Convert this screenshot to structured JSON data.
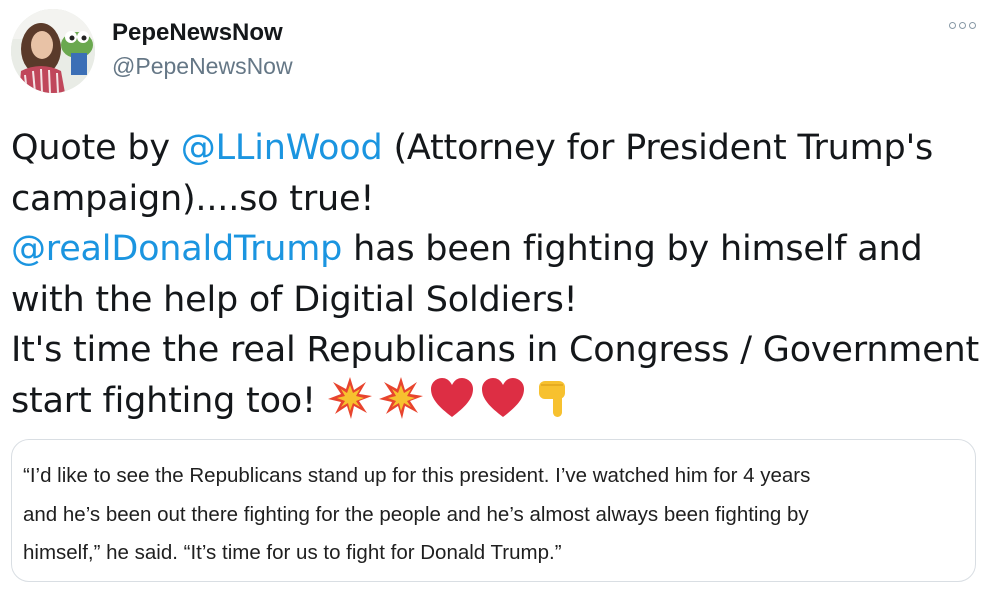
{
  "user": {
    "display_name": "PepeNewsNow",
    "handle": "@PepeNewsNow",
    "avatar_icon": "profile-photo"
  },
  "more_icon": "more-options-icon",
  "tweet": {
    "line1": {
      "pre": "Quote by ",
      "mention": "@LLinWood",
      "post": " (Attorney for President Trump's"
    },
    "line2": "campaign)....so true!",
    "line3": {
      "mention": "@realDonaldTrump",
      "post": " has been fighting by himself and"
    },
    "line4": "with the help of Digitial Soldiers!",
    "line5": "It's time the real Republicans in Congress / Government",
    "line6": "start fighting too!",
    "emojis": [
      "collision-icon",
      "collision-icon",
      "red-heart-icon",
      "red-heart-icon",
      "pointing-down-icon"
    ]
  },
  "quote": {
    "line1": "“I’d like to see the Republicans stand up for this president. I’ve watched him for 4 years",
    "line2": "and he’s been out there fighting for the people and he’s almost always been fighting by",
    "line3": "himself,” he said. “It’s time for us to fight for Donald Trump.”"
  },
  "colors": {
    "mention": "#1b95e0",
    "text": "#14171a",
    "secondary": "#657786",
    "border": "#d9dee3"
  }
}
